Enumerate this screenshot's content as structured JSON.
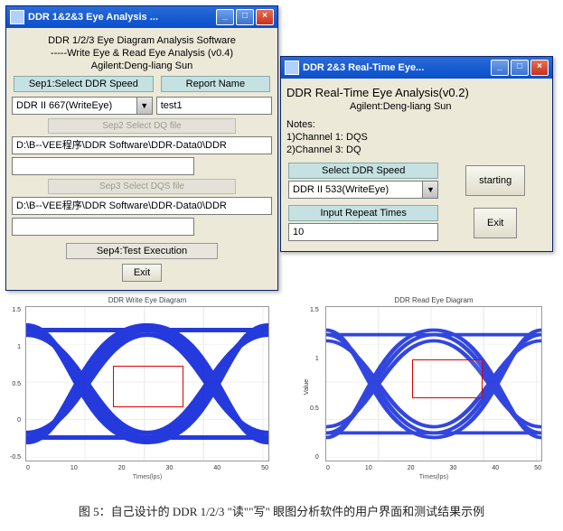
{
  "window1": {
    "title": "DDR 1&2&3 Eye Analysis ...",
    "line1": "DDR 1/2/3  Eye Diagram Analysis Software",
    "line2": "-----Write Eye & Read Eye Analysis (v0.4)",
    "line3": "Agilent:Deng-liang Sun",
    "hdr_speed": "Sep1:Select DDR Speed",
    "hdr_report": "Report Name",
    "combo_speed": "DDR II 667(WriteEye)",
    "report_name": "test1",
    "disabled2": "Sep2 Select DQ file",
    "path1": "D:\\B--VEE程序\\DDR Software\\DDR-Data0\\DDR",
    "disabled3": "Sep3 Select DQS file",
    "path2": "D:\\B--VEE程序\\DDR Software\\DDR-Data0\\DDR",
    "hdr_exec": "Sep4:Test Execution",
    "exit": "Exit"
  },
  "window2": {
    "title": "DDR 2&3 Real-Time Eye...",
    "line1": "DDR Real-Time Eye Analysis(v0.2)",
    "line2": "Agilent:Deng-liang Sun",
    "notes": "Notes:",
    "ch1": "1)Channel 1: DQS",
    "ch2": "2)Channel 3: DQ",
    "hdr_speed": "Select DDR Speed",
    "combo_speed": "DDR II 533(WriteEye)",
    "hdr_repeat": "Input Repeat Times",
    "repeat_val": "10",
    "btn_start": "starting",
    "btn_exit": "Exit"
  },
  "chart1": {
    "title": "DDR Write Eye Diagram",
    "yticks": [
      "1.5",
      "1",
      "0.5",
      "0",
      "-0.5"
    ],
    "xticks": [
      "0",
      "10",
      "20",
      "30",
      "40",
      "50"
    ],
    "xlabel": "Times(lps)"
  },
  "chart2": {
    "title": "DDR Read Eye Diagram",
    "yticks": [
      "1.5",
      "1",
      "0.5",
      "0"
    ],
    "xticks": [
      "0",
      "10",
      "20",
      "30",
      "40",
      "50"
    ],
    "xlabel": "Times(lps)",
    "ylabel": "Value"
  },
  "caption": "图 5：自己设计的 DDR 1/2/3 \"读\"\"写\" 眼图分析软件的用户界面和测试结果示例",
  "chart_data": [
    {
      "type": "line",
      "title": "DDR Write Eye Diagram",
      "xlabel": "Times(lps)",
      "ylabel": "",
      "xlim": [
        0,
        50
      ],
      "ylim": [
        -0.5,
        1.5
      ],
      "note": "eye-diagram: many overlaid traces; red mask box approx x[18,32] y[0.3,0.9]"
    },
    {
      "type": "line",
      "title": "DDR Read Eye Diagram",
      "xlabel": "Times(lps)",
      "ylabel": "Value",
      "xlim": [
        0,
        50
      ],
      "ylim": [
        0,
        1.8
      ],
      "note": "eye-diagram: many overlaid traces; red mask box approx x[20,36] y[0.6,1.1]"
    }
  ]
}
